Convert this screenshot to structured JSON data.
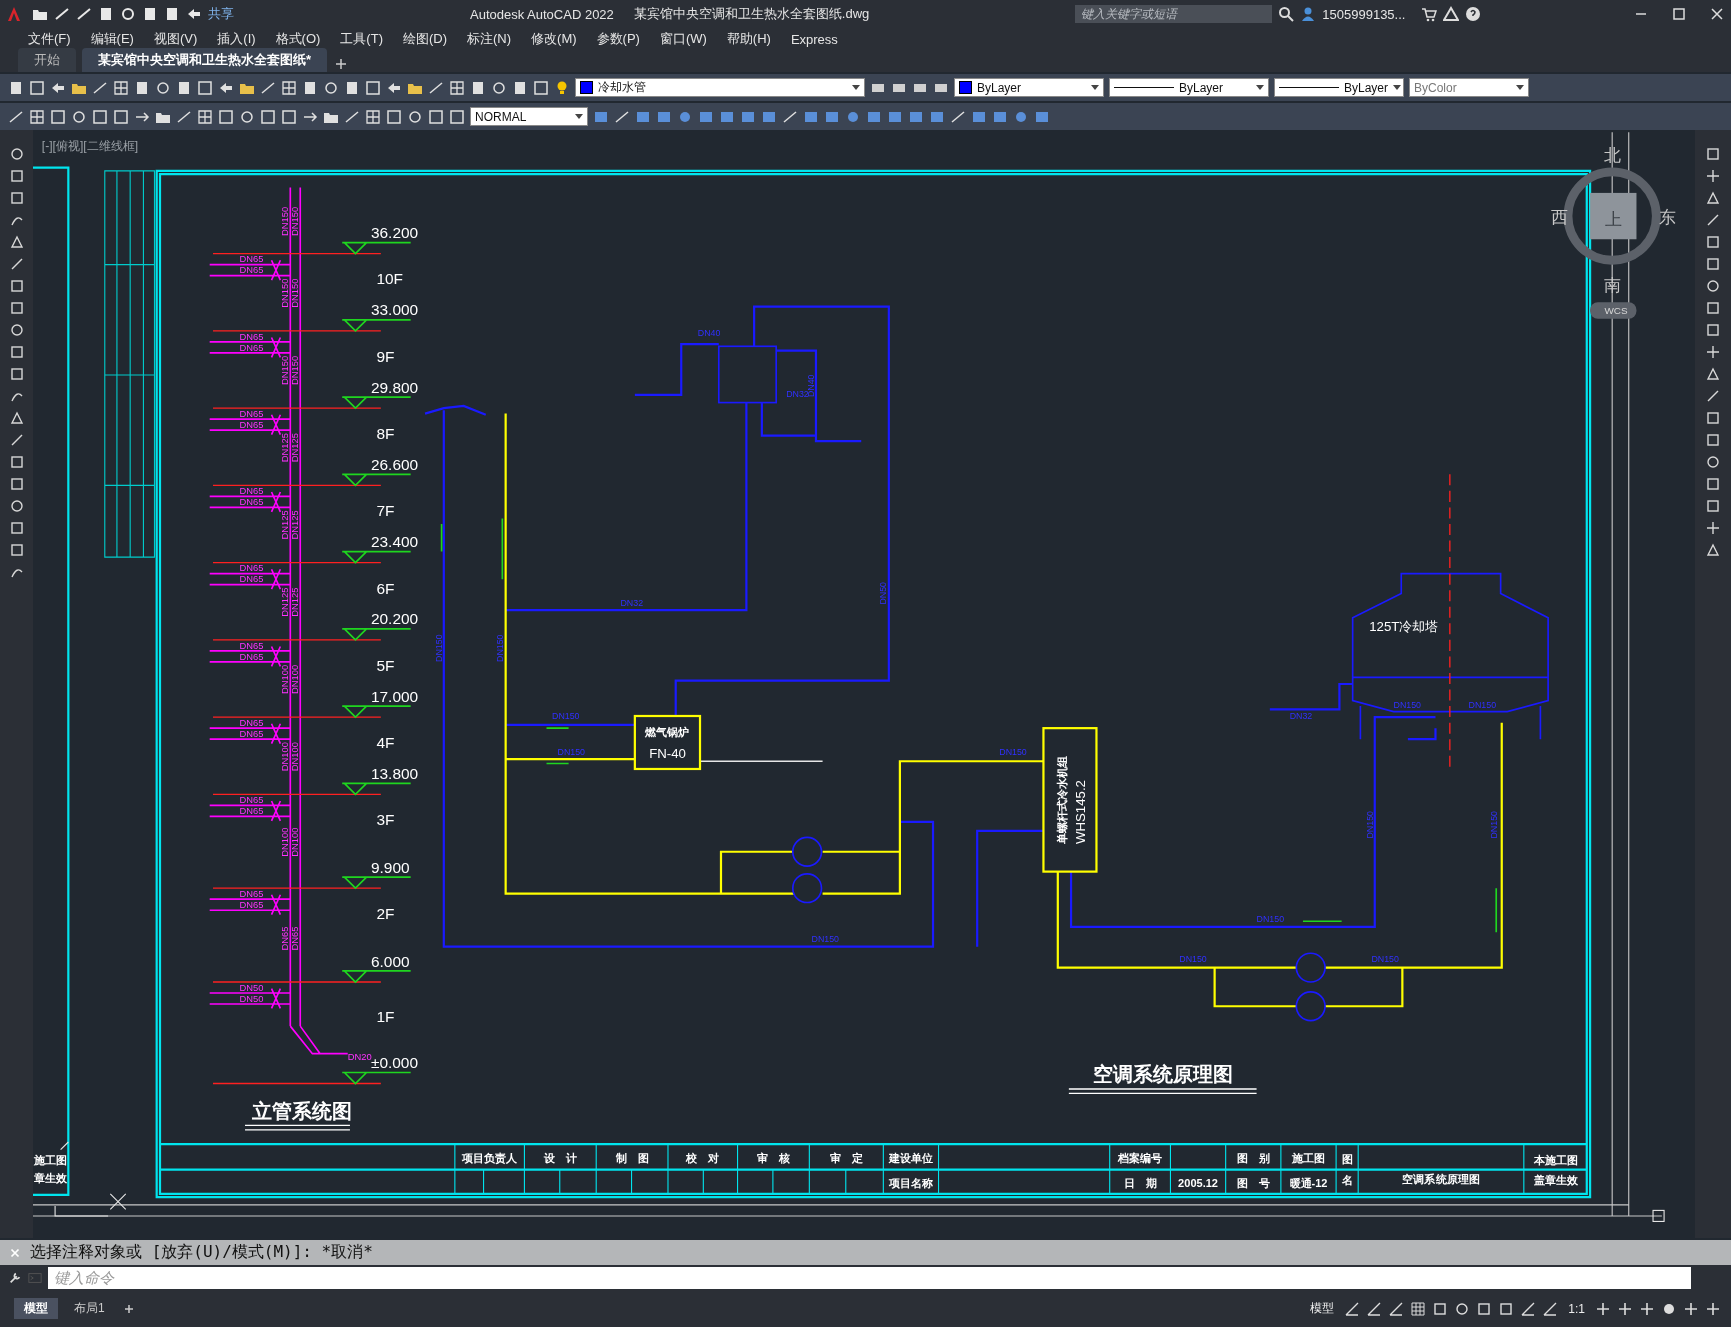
{
  "title_bar": {
    "share": "共享",
    "app": "Autodesk AutoCAD 2022",
    "file": "某宾馆中央空调和卫生热水全套图纸.dwg",
    "search": {
      "placeholder": "键入关键字或短语"
    },
    "user": "1505999135..."
  },
  "menu": [
    "文件(F)",
    "编辑(E)",
    "视图(V)",
    "插入(I)",
    "格式(O)",
    "工具(T)",
    "绘图(D)",
    "标注(N)",
    "修改(M)",
    "参数(P)",
    "窗口(W)",
    "帮助(H)",
    "Express"
  ],
  "doc_tabs": [
    {
      "label": "开始",
      "selected": false
    },
    {
      "label": "某宾馆中央空调和卫生热水全套图纸*",
      "selected": true
    }
  ],
  "properties": {
    "layer": "冷却水管",
    "color_setting": "ByLayer",
    "linetype": "ByLayer",
    "lineweight": "ByLayer",
    "plot_style": "ByColor",
    "text_style": "NORMAL"
  },
  "viewport_label": "[-][俯视][二维线框]",
  "viewcube": {
    "north": "北",
    "south": "南",
    "west": "西",
    "east": "东",
    "face": "上",
    "ucs": "WCS"
  },
  "riser": {
    "title": "立管系统图",
    "ground": "±0.000",
    "inlet": "DN20",
    "floors": [
      {
        "elevation": "36.200",
        "floor": "10F",
        "branches": [
          "DN65",
          "DN65"
        ],
        "riser": [
          "DN150",
          "DN150"
        ]
      },
      {
        "elevation": "33.000",
        "floor": "9F",
        "branches": [
          "DN65",
          "DN65"
        ],
        "riser": [
          "DN150",
          "DN150"
        ]
      },
      {
        "elevation": "29.800",
        "floor": "8F",
        "branches": [
          "DN65",
          "DN65"
        ],
        "riser": [
          "DN150",
          "DN150"
        ]
      },
      {
        "elevation": "26.600",
        "floor": "7F",
        "branches": [
          "DN65",
          "DN65"
        ],
        "riser": [
          "DN125",
          "DN125"
        ]
      },
      {
        "elevation": "23.400",
        "floor": "6F",
        "branches": [
          "DN65",
          "DN65"
        ],
        "riser": [
          "DN125",
          "DN125"
        ]
      },
      {
        "elevation": "20.200",
        "floor": "5F",
        "branches": [
          "DN65",
          "DN65"
        ],
        "riser": [
          "DN125",
          "DN125"
        ]
      },
      {
        "elevation": "17.000",
        "floor": "4F",
        "branches": [
          "DN65",
          "DN65"
        ],
        "riser": [
          "DN100",
          "DN100"
        ]
      },
      {
        "elevation": "13.800",
        "floor": "3F",
        "branches": [
          "DN65",
          "DN65"
        ],
        "riser": [
          "DN100",
          "DN100"
        ]
      },
      {
        "elevation": "9.900",
        "floor": "2F",
        "branches": [
          "DN65",
          "DN65"
        ],
        "riser": [
          "DN100",
          "DN100"
        ]
      },
      {
        "elevation": "6.000",
        "floor": "1F",
        "branches": [
          "DN50",
          "DN50"
        ],
        "riser": [
          "DN65",
          "DN65"
        ]
      }
    ]
  },
  "schematic": {
    "title": "空调系统原理图",
    "boiler": {
      "name": "燃气锅炉",
      "model": "FN-40"
    },
    "chiller": {
      "name": "单螺杆式冷水机组",
      "model": "WHS145.2"
    },
    "tower": "125T冷却塔",
    "pipe_labels": [
      "DN40",
      "DN32",
      "DN40",
      "DN32",
      "DN50",
      "DN150",
      "DN150",
      "DN150",
      "DN150",
      "DN150",
      "DN150",
      "DN150",
      "DN150",
      "DN150",
      "DN150",
      "DN150",
      "DN150",
      "DN150",
      "DN32"
    ]
  },
  "title_block": {
    "row1": [
      "项目负责人",
      "设　计",
      "制　图",
      "校　对",
      "审　核",
      "审　定",
      "建设单位",
      "档案编号",
      "图　别",
      "施工图"
    ],
    "row2": [
      "项目名称",
      "日　期",
      "2005.12",
      "图　号",
      "暖通-12"
    ],
    "name_label": "图名",
    "drawing_name": "空调系统原理图",
    "stamp": [
      "本施工图",
      "盖章生效"
    ]
  },
  "side_sheet": [
    "施工图",
    "章生效"
  ],
  "command": {
    "history": "选择注释对象或 [放弃(U)/模式(M)]: *取消*",
    "placeholder": "键入命令"
  },
  "layout_tabs": [
    {
      "label": "模型",
      "selected": true
    },
    {
      "label": "布局1",
      "selected": false
    }
  ],
  "status": {
    "space": "模型",
    "scale": "1:1"
  }
}
